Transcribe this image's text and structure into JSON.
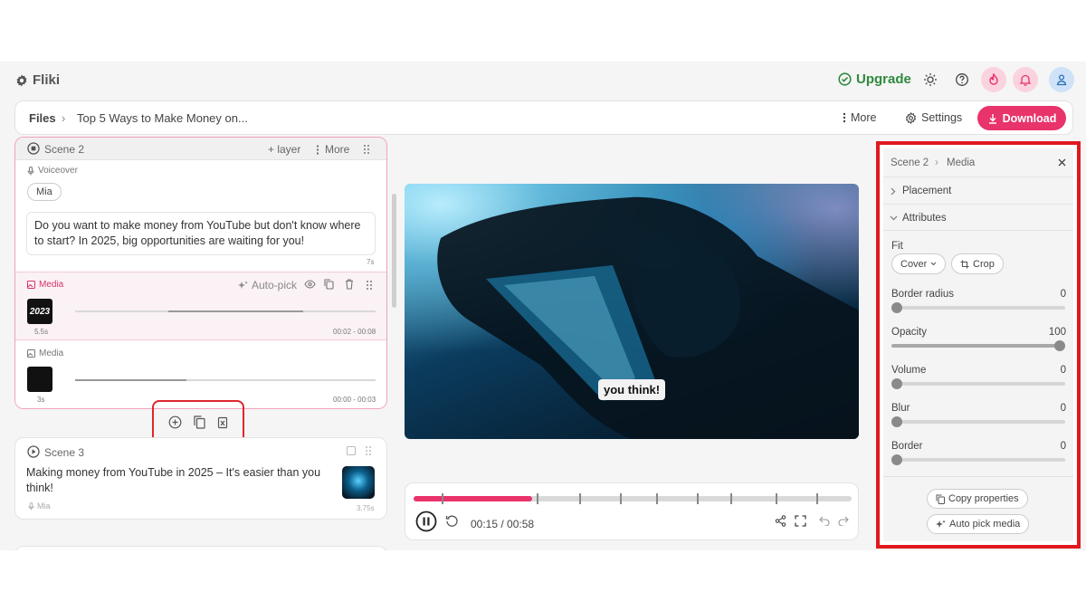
{
  "app": {
    "name": "Fliki"
  },
  "topbar": {
    "upgrade_label": "Upgrade"
  },
  "breadcrumb": {
    "root": "Files",
    "separator": "›",
    "title": "Top 5 Ways to Make Money on..."
  },
  "toolbar": {
    "more_label": "More",
    "settings_label": "Settings",
    "download_label": "Download"
  },
  "scene2": {
    "title": "Scene 2",
    "add_layer_label": "+ layer",
    "more_label": "More",
    "voiceover_label": "Voiceover",
    "voice_name": "Mia",
    "script_text": "Do you want to make money from YouTube but don't know where to start? In 2025, big opportunities are waiting for you!",
    "script_duration": "7s",
    "media1": {
      "label": "Media",
      "autopick_label": "Auto-pick",
      "thumb_text": "2023",
      "duration": "5.5s",
      "range": "00:02 - 00:08",
      "progress": 0.45
    },
    "media2": {
      "label": "Media",
      "duration": "3s",
      "range": "00:00 - 00:03",
      "progress": 0.37
    }
  },
  "scene3": {
    "title": "Scene 3",
    "script_text": "Making money from YouTube in 2025 – It's easier than you think!",
    "voice_name": "Mia",
    "duration": "3.75s"
  },
  "video": {
    "caption": "you think!"
  },
  "player": {
    "current_time": "00:15",
    "total_time": "00:58",
    "time_display": "00:15 / 00:58",
    "progress": 0.27
  },
  "panel": {
    "breadcrumb_scene": "Scene 2",
    "breadcrumb_separator": "›",
    "breadcrumb_section": "Media",
    "placement_label": "Placement",
    "attributes_label": "Attributes",
    "fit_label": "Fit",
    "fit_value": "Cover",
    "crop_label": "Crop",
    "sliders": [
      {
        "label": "Border radius",
        "value": "0"
      },
      {
        "label": "Opacity",
        "value": "100"
      },
      {
        "label": "Volume",
        "value": "0"
      },
      {
        "label": "Blur",
        "value": "0"
      },
      {
        "label": "Border",
        "value": "0"
      }
    ],
    "copy_properties_label": "Copy properties",
    "auto_pick_label": "Auto pick media"
  },
  "colors": {
    "accent": "#e8336b",
    "upgrade": "#2f8a3e",
    "highlight": "#e0191f"
  }
}
